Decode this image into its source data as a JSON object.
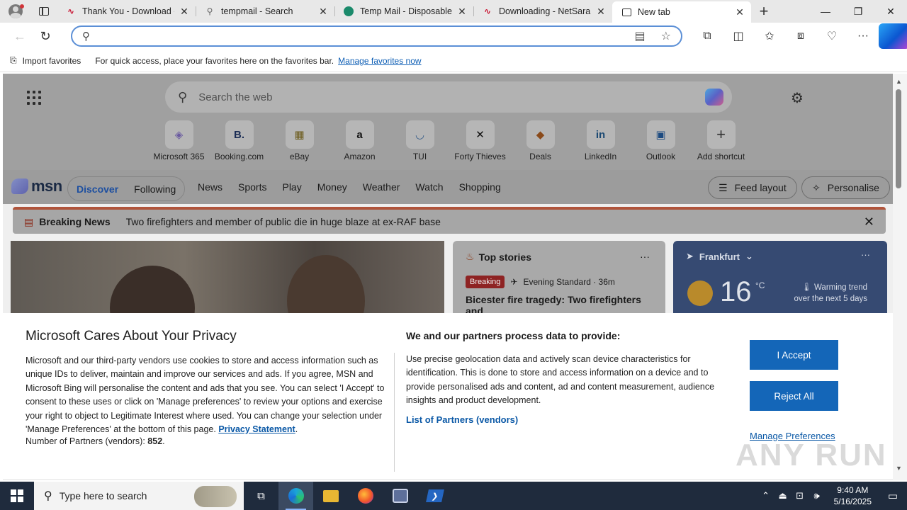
{
  "browser": {
    "tabs": [
      {
        "title": "Thank You - Download -",
        "icon": "netsarang-icon",
        "active": false
      },
      {
        "title": "tempmail - Search",
        "icon": "search-icon",
        "active": false
      },
      {
        "title": "Temp Mail - Disposable T",
        "icon": "tempmail-icon",
        "active": false
      },
      {
        "title": "Downloading - NetSaran",
        "icon": "netsarang-icon",
        "active": false
      },
      {
        "title": "New tab",
        "icon": "newtab-icon",
        "active": true
      }
    ],
    "address_value": "",
    "favorites_bar": {
      "import_label": "Import favorites",
      "hint": "For quick access, place your favorites here on the favorites bar.",
      "manage_link": "Manage favorites now"
    }
  },
  "newtab": {
    "search_placeholder": "Search the web",
    "shortcuts": [
      {
        "label": "Microsoft 365",
        "glyph": "◈"
      },
      {
        "label": "Booking.com",
        "glyph": "B."
      },
      {
        "label": "eBay",
        "glyph": "▦"
      },
      {
        "label": "Amazon",
        "glyph": "a"
      },
      {
        "label": "TUI",
        "glyph": "◡"
      },
      {
        "label": "Forty Thieves",
        "glyph": "✕"
      },
      {
        "label": "Deals",
        "glyph": "◆"
      },
      {
        "label": "LinkedIn",
        "glyph": "in"
      },
      {
        "label": "Outlook",
        "glyph": "▣"
      },
      {
        "label": "Add shortcut",
        "glyph": "+"
      }
    ],
    "msn": {
      "logo": "msn",
      "tabs": [
        "Discover",
        "Following"
      ],
      "nav": [
        "News",
        "Sports",
        "Play",
        "Money",
        "Weather",
        "Watch",
        "Shopping"
      ],
      "feed_layout": "Feed layout",
      "personalise": "Personalise"
    },
    "breaking": {
      "label": "Breaking News",
      "text": "Two firefighters and member of public die in huge blaze at ex-RAF base"
    },
    "top_stories": {
      "title": "Top stories",
      "badge": "Breaking",
      "source": "Evening Standard · 36m",
      "headline": "Bicester fire tragedy: Two firefighters and"
    },
    "weather": {
      "city": "Frankfurt",
      "temp": "16",
      "unit": "°C",
      "trend_line1": "Warming trend",
      "trend_line2": "over the next 5 days"
    }
  },
  "privacy": {
    "title": "Microsoft Cares About Your Privacy",
    "body": "Microsoft and our third-party vendors use cookies to store and access information such as unique IDs to deliver, maintain and improve our services and ads. If you agree, MSN and Microsoft Bing will personalise the content and ads that you see. You can select 'I Accept' to consent to these uses or click on 'Manage preferences' to review your options and exercise your right to object to Legitimate Interest where used.  You can change your selection under 'Manage Preferences' at the bottom of this page.",
    "privacy_link": "Privacy Statement",
    "partners_label": "Number of Partners (vendors):",
    "partners_count": "852",
    "purposes_title": "We and our partners process data to provide:",
    "purposes_text": "Use precise geolocation data and actively scan device characteristics for identification. This is done to store and access information on a device and to provide personalised ads and content, ad and content measurement, audience insights and product development.",
    "vendors_link": "List of Partners (vendors)",
    "accept": "I Accept",
    "reject": "Reject All",
    "manage": "Manage Preferences",
    "watermark": "ANY RUN"
  },
  "taskbar": {
    "search_placeholder": "Type here to search",
    "time": "9:40 AM",
    "date": "5/16/2025"
  }
}
